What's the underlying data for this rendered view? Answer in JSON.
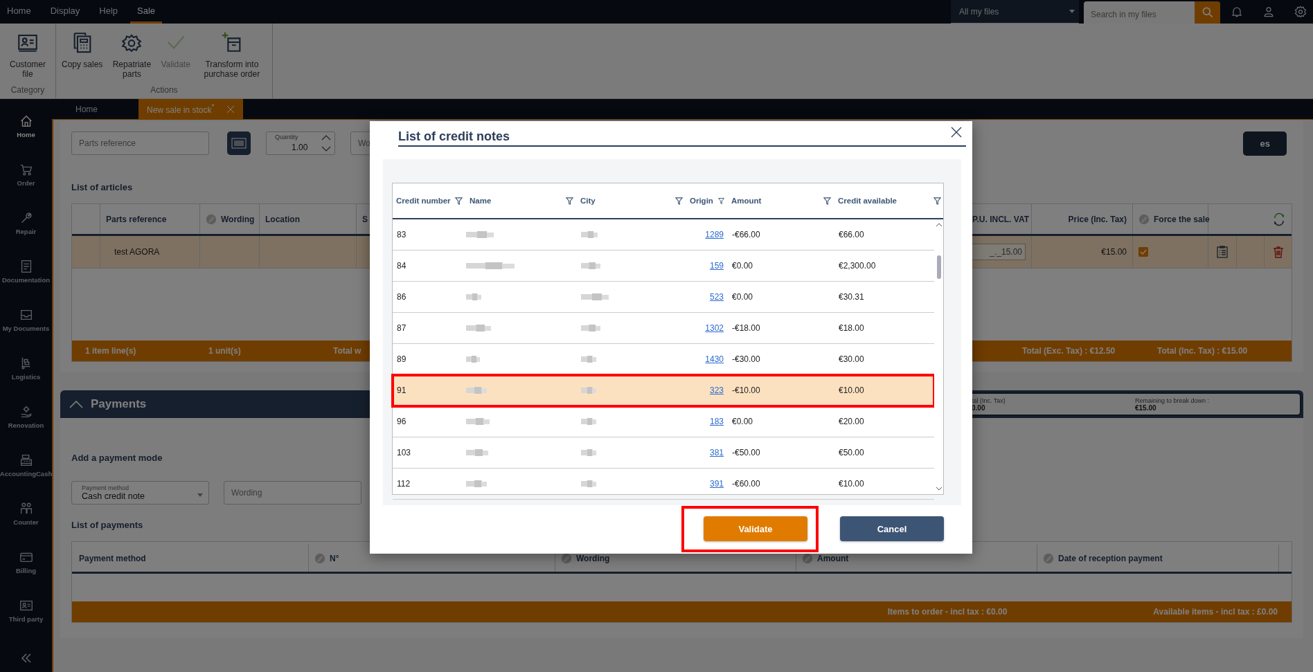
{
  "menu": [
    {
      "label": "Home",
      "selected": false
    },
    {
      "label": "Display",
      "selected": false
    },
    {
      "label": "Help",
      "selected": false
    },
    {
      "label": "Sale",
      "selected": true
    }
  ],
  "file_scope": {
    "value": "All my files"
  },
  "search": {
    "placeholder": "Search in my files"
  },
  "ribbon": {
    "groups": [
      {
        "title": "Category",
        "items": [
          {
            "label": "Customer file",
            "kind": "customer",
            "disabled": false
          }
        ]
      },
      {
        "title": "Actions",
        "items": [
          {
            "label": "Copy sales",
            "kind": "copy",
            "disabled": false
          },
          {
            "label": "Repatriate parts",
            "kind": "repatriate",
            "disabled": false
          },
          {
            "label": "Validate",
            "kind": "validate",
            "disabled": true
          },
          {
            "label": "Transform into purchase order",
            "kind": "transform",
            "disabled": false
          }
        ]
      }
    ]
  },
  "sidebar": {
    "items": [
      {
        "label": "Home",
        "kind": "home",
        "selected": true
      },
      {
        "label": "Order",
        "kind": "order",
        "selected": false
      },
      {
        "label": "Repair",
        "kind": "repair",
        "selected": false
      },
      {
        "label": "Documentation",
        "kind": "documentation",
        "selected": false
      },
      {
        "label": "My Documents",
        "kind": "my_documents",
        "selected": false
      },
      {
        "label": "Logistics",
        "kind": "logistics",
        "selected": false
      },
      {
        "label": "Renovation",
        "kind": "renovation",
        "selected": false
      },
      {
        "label": "AccountingCash",
        "kind": "accounting",
        "selected": false
      },
      {
        "label": "Counter",
        "kind": "counter",
        "selected": false
      },
      {
        "label": "Billing",
        "kind": "billing",
        "selected": false
      },
      {
        "label": "Third party",
        "kind": "third_party",
        "selected": false
      }
    ]
  },
  "doc_tabs": [
    {
      "label": "Home",
      "selected": false
    },
    {
      "label": "New sale in stock$^{*}$",
      "selected": true
    }
  ],
  "article_entry": {
    "parts_reference_placeholder": "Parts reference",
    "quantity_label": "Quantity",
    "quantity": "1.00",
    "wording_placeholder": "Wo",
    "button_label": "es"
  },
  "articles": {
    "title": "List of articles",
    "columns": [
      {
        "label": "Parts reference",
        "editable": false
      },
      {
        "label": "Wording",
        "editable": true
      },
      {
        "label": "Location",
        "editable": false
      },
      {
        "label": "S",
        "editable": false
      },
      {
        "label": "P.U. INCL. VAT",
        "editable": false
      },
      {
        "label": "Price (Inc. Tax)",
        "editable": false
      },
      {
        "label": "Force the sale",
        "editable": true
      }
    ],
    "rows": [
      {
        "parts_reference": "test AGORA",
        "unit_price": "_._15.00",
        "price": "€15.00",
        "force_sale": true
      }
    ],
    "footer": [
      "1 item line(s)",
      "1 unit(s)",
      "Total w",
      "Total (Exc. Tax) : €12.50",
      "Total (Inc. Tax) : €15.00"
    ]
  },
  "payments": {
    "title": "Payments",
    "expanded": true,
    "summary": [
      {
        "label": "tal (Inc. Tax)",
        "value": "0.00"
      },
      {
        "label": "Remaining to break down :",
        "value": "€15.00"
      }
    ],
    "add_title": "Add a payment mode",
    "method": {
      "label": "Payment method",
      "value": "Cash credit note"
    },
    "wording_placeholder": "Wording",
    "list_title": "List of payments",
    "columns": [
      {
        "label": "Payment method",
        "editable": false
      },
      {
        "label": "N°",
        "editable": true
      },
      {
        "label": "Wording",
        "editable": true
      },
      {
        "label": "Amount",
        "editable": true
      },
      {
        "label": "Date of reception payment",
        "editable": true
      }
    ],
    "footer": [
      "Items to order - incl tax : €0.00",
      "Available items - incl tax : £0.00"
    ]
  },
  "dialog": {
    "title": "List of credit notes",
    "columns": [
      {
        "label": "Credit number"
      },
      {
        "label": "Name"
      },
      {
        "label": "City"
      },
      {
        "label": "Origin"
      },
      {
        "label": "Amount"
      },
      {
        "label": "Credit available"
      }
    ],
    "rows": [
      {
        "credit_number": "83",
        "origin": "1289",
        "amount": "-€66.00",
        "credit_available": "€66.00",
        "selected": false,
        "highlighted": false
      },
      {
        "credit_number": "84",
        "origin": "159",
        "amount": "€0.00",
        "credit_available": "€2,300.00",
        "selected": false,
        "highlighted": false
      },
      {
        "credit_number": "86",
        "origin": "523",
        "amount": "€0.00",
        "credit_available": "€30.31",
        "selected": false,
        "highlighted": false
      },
      {
        "credit_number": "87",
        "origin": "1302",
        "amount": "-€18.00",
        "credit_available": "€18.00",
        "selected": false,
        "highlighted": false
      },
      {
        "credit_number": "89",
        "origin": "1430",
        "amount": "-€30.00",
        "credit_available": "€30.00",
        "selected": false,
        "highlighted": false
      },
      {
        "credit_number": "91",
        "origin": "323",
        "amount": "-€10.00",
        "credit_available": "€10.00",
        "selected": true,
        "highlighted": true
      },
      {
        "credit_number": "96",
        "origin": "183",
        "amount": "€0.00",
        "credit_available": "€20.00",
        "selected": false,
        "highlighted": false
      },
      {
        "credit_number": "103",
        "origin": "381",
        "amount": "-€50.00",
        "credit_available": "€50.00",
        "selected": false,
        "highlighted": false
      },
      {
        "credit_number": "112",
        "origin": "391",
        "amount": "-€60.00",
        "credit_available": "€10.00",
        "selected": false,
        "highlighted": false
      }
    ],
    "buttons": [
      {
        "label": "Validate",
        "kind": "primary",
        "highlighted": true
      },
      {
        "label": "Cancel",
        "kind": "secondary",
        "highlighted": false
      }
    ]
  }
}
